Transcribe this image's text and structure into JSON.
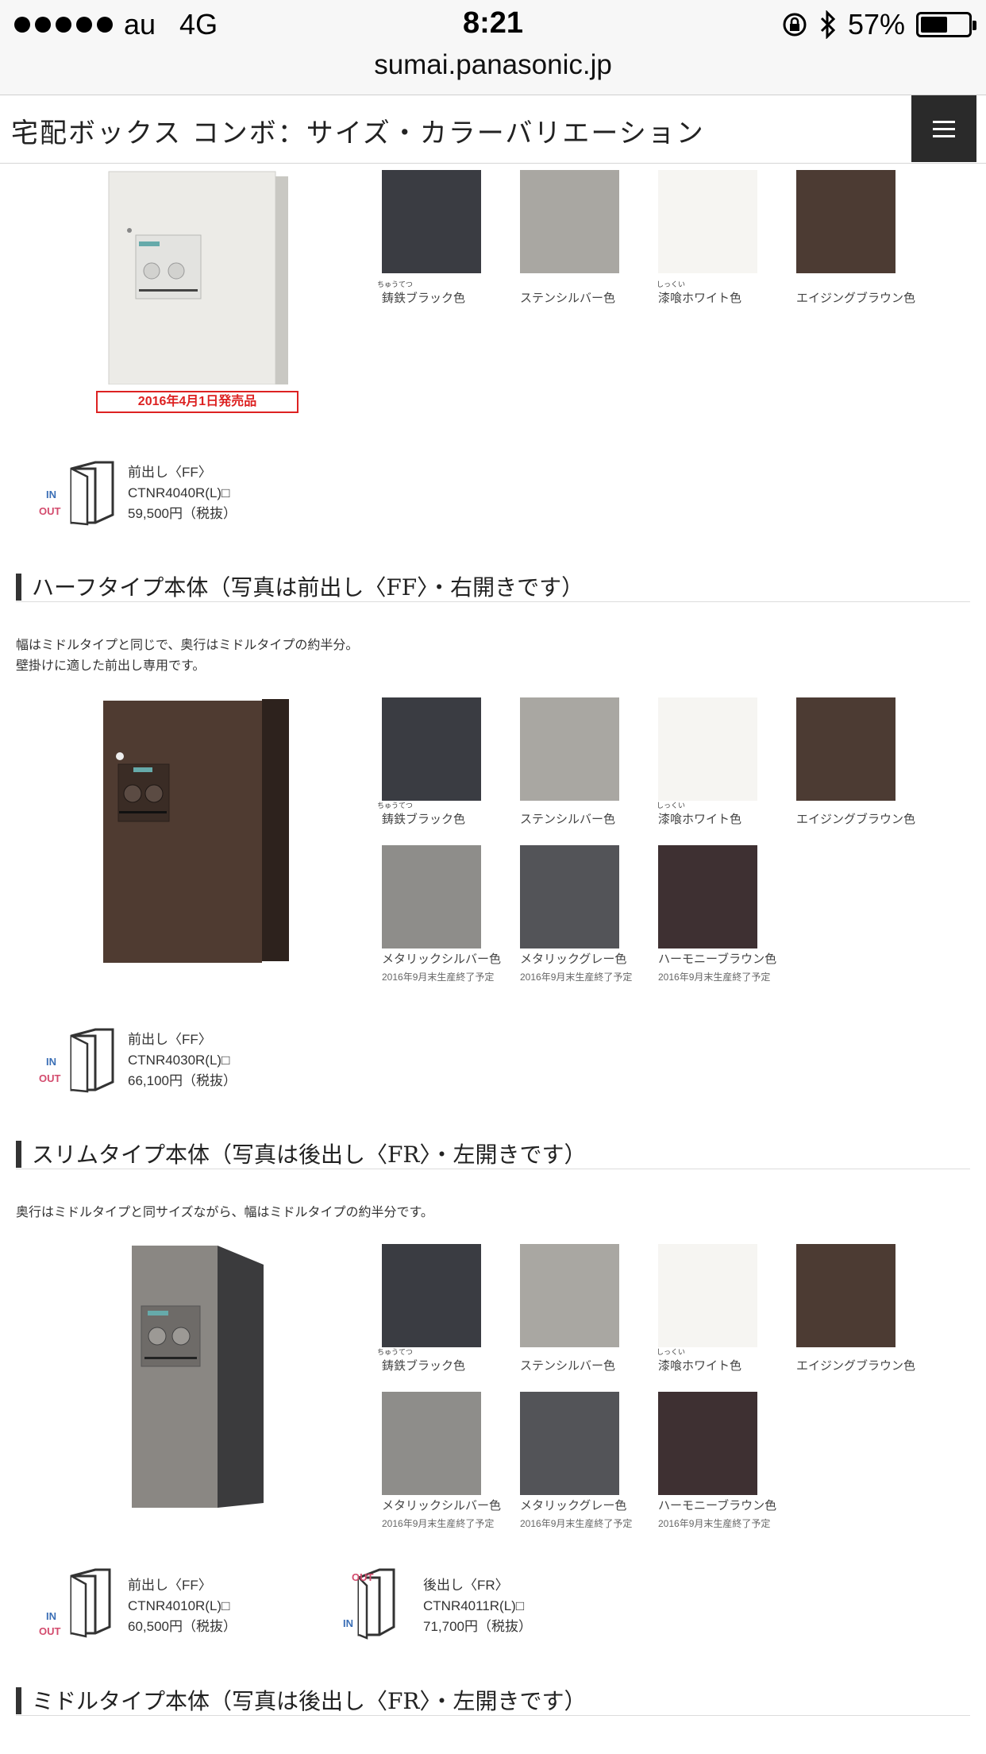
{
  "status_bar": {
    "carrier": "au",
    "network": "4G",
    "time": "8:21",
    "battery": "57%",
    "battery_level": 0.57
  },
  "url": "sumai.panasonic.jp",
  "header": {
    "title": "宅配ボックス コンボ：サイズ・カラーバリエーション",
    "menu_icon": "hamburger-icon"
  },
  "colors": {
    "black": "#3a3c42",
    "stain": "#a9a7a2",
    "white": "#f6f5f2",
    "aging": "#4c3b33",
    "metallic_silver": "#8e8d8a",
    "metallic_gray": "#535458",
    "harmony": "#3e3032",
    "accent_red": "#dd2222"
  },
  "swatch_labels": {
    "black": "鋳鉄ブラック色",
    "black_ruby": "ちゅうてつ",
    "stain": "ステンシルバー色",
    "white": "漆喰ホワイト色",
    "white_ruby": "しっくい",
    "aging": "エイジングブラウン色",
    "metallic_silver": "メタリックシルバー色",
    "metallic_gray": "メタリックグレー色",
    "harmony": "ハーモニーブラウン色",
    "discontinued_note": "2016年9月末生産終了予定"
  },
  "top_section": {
    "date_tag": "2016年4月1日発売品",
    "spec": {
      "io_in": "IN",
      "io_out": "OUT",
      "type": "前出し〈FF〉",
      "model": "CTNR4040R(L)□",
      "price": "59,500円（税抜）"
    }
  },
  "half_section": {
    "title": "ハーフタイプ本体（写真は前出し〈FF〉・右開きです）",
    "desc_line1": "幅はミドルタイプと同じで、奥行はミドルタイプの約半分。",
    "desc_line2": "壁掛けに適した前出し専用です。",
    "spec": {
      "io_in": "IN",
      "io_out": "OUT",
      "type": "前出し〈FF〉",
      "model": "CTNR4030R(L)□",
      "price": "66,100円（税抜）"
    }
  },
  "slim_section": {
    "title": "スリムタイプ本体（写真は後出し〈FR〉・左開きです）",
    "desc_line1": "奥行はミドルタイプと同サイズながら、幅はミドルタイプの約半分です。",
    "spec_ff": {
      "io_in": "IN",
      "io_out": "OUT",
      "type": "前出し〈FF〉",
      "model": "CTNR4010R(L)□",
      "price": "60,500円（税抜）"
    },
    "spec_fr": {
      "io_in": "IN",
      "io_out": "OUT",
      "type": "後出し〈FR〉",
      "model": "CTNR4011R(L)□",
      "price": "71,700円（税抜）"
    }
  },
  "middle_section": {
    "title": "ミドルタイプ本体（写真は後出し〈FR〉・左開きです）"
  }
}
